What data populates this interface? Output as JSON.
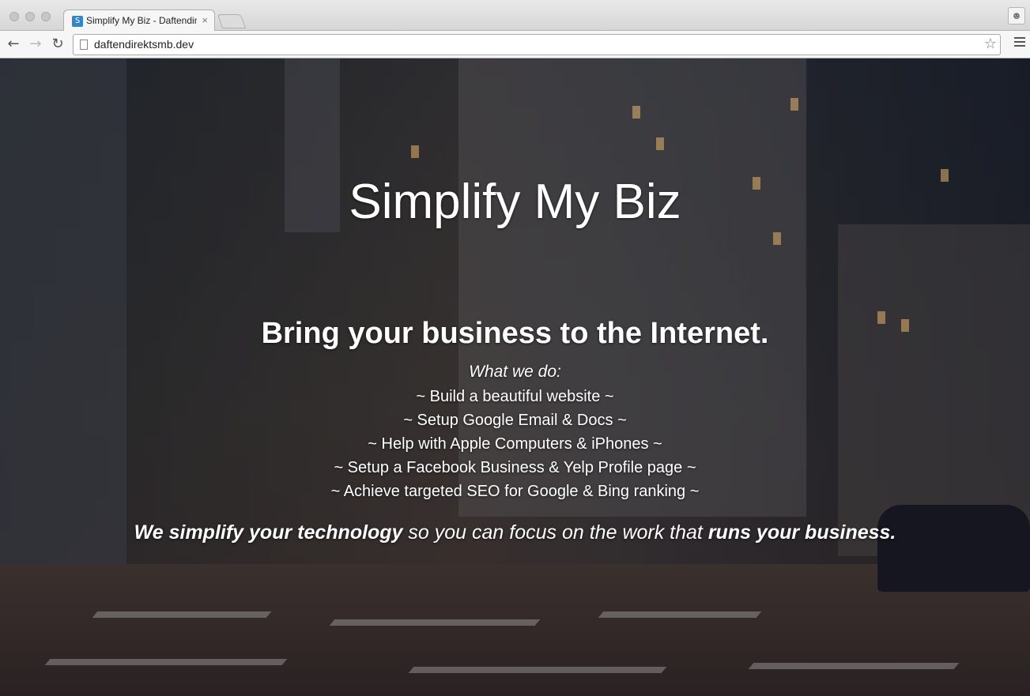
{
  "browser": {
    "tab_title": "Simplify My Biz - Daftendirektsmb",
    "tab_favicon": "S",
    "tab_close": "×",
    "address": "daftendirektsmb.dev",
    "icons": {
      "back": "arrow-left-icon",
      "forward": "arrow-right-icon",
      "reload": "reload-icon",
      "bookmark": "star-icon",
      "menu": "hamburger-menu-icon",
      "profile": "person-icon"
    }
  },
  "page": {
    "title": "Simplify My Biz",
    "tagline": "Bring your business to the Internet.",
    "what_we_do": "What we do:",
    "services": [
      "~ Build a beautiful website ~",
      "~ Setup Google Email & Docs ~",
      "~ Help with Apple Computers & iPhones ~",
      "~ Setup a Facebook Business & Yelp Profile page ~",
      "~ Achieve targeted SEO for Google & Bing ranking ~"
    ],
    "motto": {
      "part1": "We simplify your technology",
      "part2": " so you can focus on the work that ",
      "part3": "runs your business."
    }
  }
}
